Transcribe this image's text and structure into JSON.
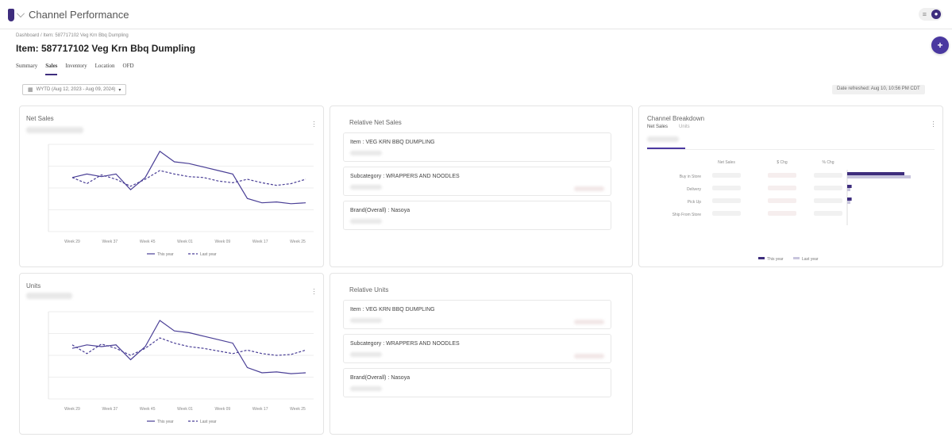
{
  "app": {
    "title": "Channel Performance"
  },
  "header": {
    "breadcrumb": "Dashboard  /  Item: 587717102 Veg Krn Bbq Dumpling",
    "item_title": "Item: 587717102 Veg Krn Bbq Dumpling",
    "tabs": [
      {
        "label": "Summary",
        "active": false
      },
      {
        "label": "Sales",
        "active": true
      },
      {
        "label": "Inventory",
        "active": false
      },
      {
        "label": "Location",
        "active": false
      },
      {
        "label": "OFD",
        "active": false
      }
    ],
    "fab_label": "+"
  },
  "toolbar": {
    "date_range": "WYTD (Aug 12, 2023 - Aug 09, 2024)",
    "date_refreshed": "Date refreshed: Aug 10, 10:56 PM CDT",
    "toggle_icon": "≡"
  },
  "colors": {
    "accent": "#3e2d7d",
    "last_year": "#c8c5dd",
    "highlight": "#e00000"
  },
  "net_sales_card": {
    "title": "Net Sales",
    "legend": [
      "This year",
      "Last year"
    ]
  },
  "units_card": {
    "title": "Units",
    "legend": [
      "This year",
      "Last year"
    ]
  },
  "relative_net_sales": {
    "title": "Relative Net Sales",
    "rows": [
      "Item : VEG KRN BBQ DUMPLING",
      "Subcategory : WRAPPERS AND NOODLES",
      "Brand(Overall) : Nasoya"
    ]
  },
  "relative_units": {
    "title": "Relative Units",
    "rows": [
      "Item : VEG KRN BBQ DUMPLING",
      "Subcategory : WRAPPERS AND NOODLES",
      "Brand(Overall) : Nasoya"
    ]
  },
  "channel_breakdown": {
    "title": "Channel Breakdown",
    "tabs": [
      "Net Sales",
      "Units"
    ],
    "columns": [
      "Net Sales",
      "$ Chg",
      "% Chg"
    ],
    "channels": [
      "Buy in Store",
      "Delivery",
      "Pick Up",
      "Ship From Store"
    ],
    "legend": [
      "This year",
      "Last year"
    ]
  },
  "chart_data": [
    {
      "type": "line",
      "title": "Net Sales",
      "x": [
        "Week 29",
        "Week 37",
        "Week 45",
        "Week 01",
        "Week 09",
        "Week 17",
        "Week 25"
      ],
      "series": [
        {
          "name": "This year",
          "values": [
            0.62,
            0.66,
            0.63,
            0.66,
            0.48,
            0.62,
            0.92,
            0.8,
            0.78,
            0.74,
            0.7,
            0.66,
            0.38,
            0.33,
            0.34,
            0.32,
            0.33
          ]
        },
        {
          "name": "Last year",
          "values": [
            0.62,
            0.55,
            0.65,
            0.6,
            0.52,
            0.6,
            0.7,
            0.66,
            0.63,
            0.62,
            0.58,
            0.56,
            0.6,
            0.56,
            0.53,
            0.55,
            0.6
          ]
        }
      ]
    },
    {
      "type": "line",
      "title": "Units",
      "x": [
        "Week 29",
        "Week 37",
        "Week 45",
        "Week 01",
        "Week 09",
        "Week 17",
        "Week 25"
      ],
      "series": [
        {
          "name": "This year",
          "values": [
            0.58,
            0.62,
            0.6,
            0.62,
            0.45,
            0.6,
            0.9,
            0.78,
            0.76,
            0.72,
            0.68,
            0.64,
            0.36,
            0.3,
            0.31,
            0.29,
            0.3
          ]
        },
        {
          "name": "Last year",
          "values": [
            0.62,
            0.52,
            0.63,
            0.58,
            0.5,
            0.58,
            0.7,
            0.64,
            0.6,
            0.58,
            0.55,
            0.52,
            0.56,
            0.52,
            0.5,
            0.51,
            0.56
          ]
        }
      ]
    },
    {
      "type": "bar",
      "title": "Channel Breakdown",
      "categories": [
        "Buy in Store",
        "Delivery",
        "Pick Up",
        "Ship From Store"
      ],
      "series": [
        {
          "name": "This year",
          "values": [
            0.9,
            0.07,
            0.07,
            0
          ]
        },
        {
          "name": "Last year",
          "values": [
            1.0,
            0.05,
            0.05,
            0
          ]
        }
      ]
    }
  ]
}
